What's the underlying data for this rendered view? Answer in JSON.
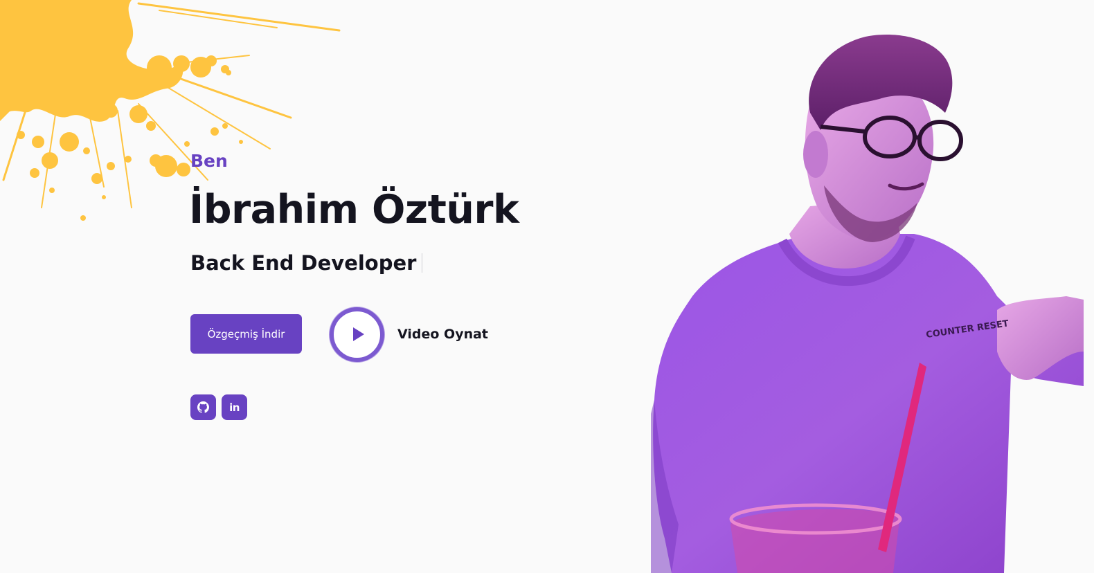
{
  "hero": {
    "intro": "Ben",
    "name": "İbrahim Öztürk",
    "role": "Back End Developer"
  },
  "actions": {
    "cv_button_label": "Özgeçmiş İndir",
    "video_label": "Video Oynat"
  },
  "socials": [
    {
      "icon": "github-icon"
    },
    {
      "icon": "linkedin-icon",
      "label": "in"
    }
  ],
  "portrait": {
    "shirt_print": "COUNTER RESET"
  },
  "colors": {
    "accent": "#6842c2",
    "splash": "#fec440",
    "background": "#fafafa",
    "text": "#14141f"
  }
}
